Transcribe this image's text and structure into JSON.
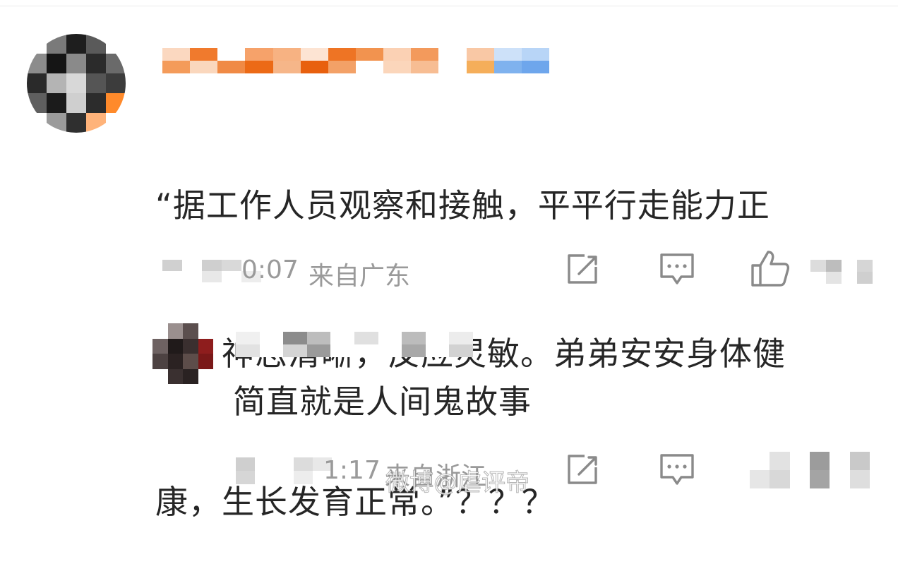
{
  "comment": {
    "text_lines": [
      "“据工作人员观察和接触，平平行走能力正",
      "常，神志清晰，反应灵敏。弟弟安安身体健",
      "康，生长发育正常。”？？？"
    ],
    "time": "0:07",
    "location": "来自广东"
  },
  "reply": {
    "text": "简直就是人间鬼故事",
    "time": "1:17",
    "location": "来自浙江"
  },
  "watermark": "微博@虐评帝",
  "colors": {
    "text": "#262626",
    "meta": "#9a9a9a",
    "icon": "#8a8a8a"
  },
  "icons": [
    "edit-icon",
    "comment-icon",
    "like-icon"
  ]
}
